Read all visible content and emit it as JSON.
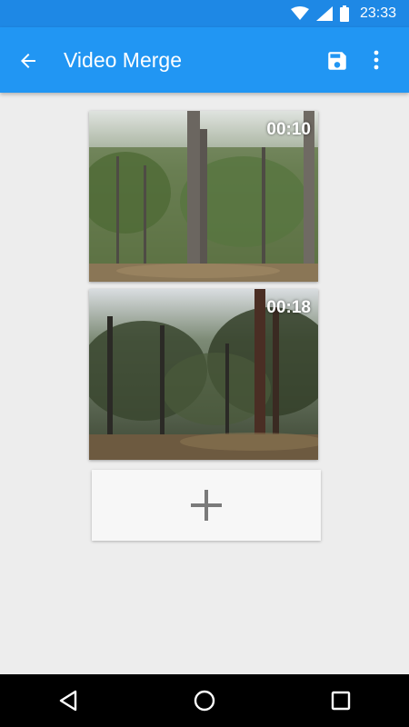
{
  "status_bar": {
    "time": "23:33",
    "icons": [
      "wifi-icon",
      "signal-icon",
      "battery-icon"
    ]
  },
  "app_bar": {
    "title": "Video Merge",
    "back_icon": "arrow-back-icon",
    "save_icon": "save-icon",
    "more_icon": "more-vert-icon",
    "color": "#2196f3"
  },
  "videos": [
    {
      "duration": "00:10"
    },
    {
      "duration": "00:18"
    }
  ],
  "add_button": {
    "icon": "plus-icon"
  },
  "nav_bar": {
    "icons": [
      "back-triangle-icon",
      "home-circle-icon",
      "recents-square-icon"
    ]
  }
}
